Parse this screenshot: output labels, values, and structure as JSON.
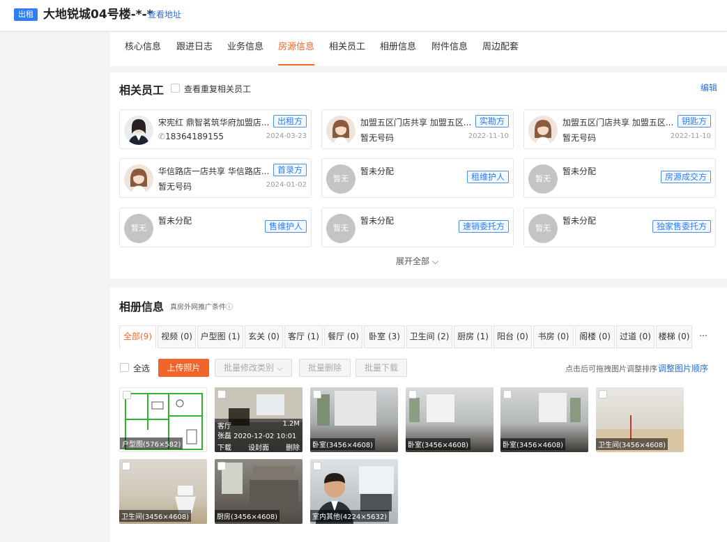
{
  "header": {
    "rent_tag": "出租",
    "title": "大地锐城04号楼-*-*",
    "view_address": "查看地址"
  },
  "tabs": [
    "核心信息",
    "跟进日志",
    "业务信息",
    "房源信息",
    "相关员工",
    "相册信息",
    "附件信息",
    "周边配套"
  ],
  "active_tab": "房源信息",
  "staff": {
    "title": "相关员工",
    "show_dup_label": "查看重复相关员工",
    "edit_label": "编辑",
    "expand_label": "展开全部 ⌵",
    "cards": [
      {
        "name": "宋宪红 鼎智茗筑华府加盟店...",
        "phone": "18364189155",
        "date": "2024-03-23",
        "role": "出租方",
        "avatar": "photo"
      },
      {
        "name": "加盟五区门店共享 加盟五区...",
        "phone": "暂无号码",
        "date": "2022-11-10",
        "role": "实勘方",
        "avatar": "woman"
      },
      {
        "name": "加盟五区门店共享 加盟五区...",
        "phone": "暂无号码",
        "date": "2022-11-10",
        "role": "钥匙方",
        "avatar": "woman"
      },
      {
        "name": "华信路店一店共享 华信路店...",
        "phone": "暂无号码",
        "date": "2024-01-02",
        "role": "首录方",
        "avatar": "woman"
      },
      {
        "name": "暂未分配",
        "phone": "",
        "date": "",
        "role": "租维护人",
        "avatar": "none"
      },
      {
        "name": "暂未分配",
        "phone": "",
        "date": "",
        "role": "房源成交方",
        "avatar": "none"
      },
      {
        "name": "暂未分配",
        "phone": "",
        "date": "",
        "role": "售维护人",
        "avatar": "none"
      },
      {
        "name": "暂未分配",
        "phone": "",
        "date": "",
        "role": "速销委托方",
        "avatar": "none"
      },
      {
        "name": "暂未分配",
        "phone": "",
        "date": "",
        "role": "独家售委托方",
        "avatar": "none"
      }
    ],
    "no_avatar_text": "暂无"
  },
  "album": {
    "title": "相册信息",
    "subtitle": "真房外网推广条件ⓘ",
    "categories": [
      "全部(9)",
      "视频 (0)",
      "户型图 (1)",
      "玄关 (0)",
      "客厅 (1)",
      "餐厅 (0)",
      "卧室 (3)",
      "卫生间 (2)",
      "厨房 (1)",
      "阳台 (0)",
      "书房 (0)",
      "阁楼 (0)",
      "过道 (0)",
      "楼梯 (0)",
      "···"
    ],
    "select_all": "全选",
    "upload": "上传照片",
    "batch_change": "批量修改类别 ⌵",
    "batch_delete": "批量删除",
    "batch_download": "批量下载",
    "hint": "点击后可拖拽图片调整排序",
    "adjust_order": "调整图片顺序",
    "photos": [
      {
        "caption": "户型图(576×582)",
        "kind": "plan"
      },
      {
        "caption": "客厅",
        "kind": "living",
        "size": "1.2M",
        "uploader": "张磊 2020-12-02 10:01",
        "actions": [
          "下载",
          "设封面",
          "删除"
        ]
      },
      {
        "caption": "卧室(3456×4608)",
        "kind": "room"
      },
      {
        "caption": "卧室(3456×4608)",
        "kind": "room"
      },
      {
        "caption": "卧室(3456×4608)",
        "kind": "room"
      },
      {
        "caption": "卫生间(3456×4608)",
        "kind": "bath"
      },
      {
        "caption": "卫生间(3456×4608)",
        "kind": "toilet"
      },
      {
        "caption": "厨房(3456×4608)",
        "kind": "kitchen"
      },
      {
        "caption": "室内其他(4224×5632)",
        "kind": "person"
      }
    ]
  },
  "colors": {
    "accent": "#f2652a",
    "link": "#2f6fd6",
    "badge": "#2f7ef4"
  }
}
